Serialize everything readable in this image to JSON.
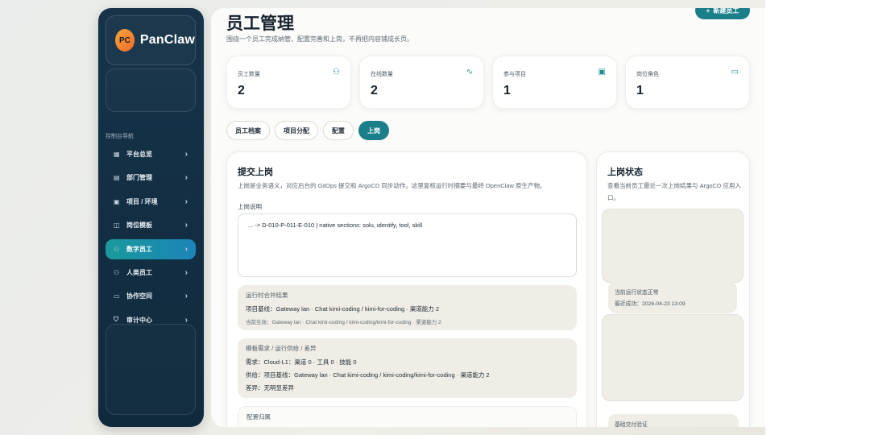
{
  "brand": {
    "badge": "PC",
    "name": "PanClaw"
  },
  "nav": {
    "section_title": "控制台导航",
    "items": [
      {
        "label": "平台总览",
        "icon": "grid-icon",
        "glyph": "▦",
        "active": false
      },
      {
        "label": "部门管理",
        "icon": "building-icon",
        "glyph": "▤",
        "active": false
      },
      {
        "label": "项目 / 环境",
        "icon": "folder-icon",
        "glyph": "▣",
        "active": false
      },
      {
        "label": "岗位模板",
        "icon": "template-icon",
        "glyph": "◫",
        "active": false
      },
      {
        "label": "数字员工",
        "icon": "users-icon",
        "glyph": "⚇",
        "active": true
      },
      {
        "label": "人类员工",
        "icon": "user-icon",
        "glyph": "⚇",
        "active": false
      },
      {
        "label": "协作空间",
        "icon": "chat-icon",
        "glyph": "▭",
        "active": false
      },
      {
        "label": "审计中心",
        "icon": "shield-icon",
        "glyph": "⛉",
        "active": false
      }
    ]
  },
  "header": {
    "title": "员工管理",
    "subtitle": "围绕一个员工完成纳管、配置完善和上岗，不再把内容铺成长页。",
    "new_button": "新建员工",
    "new_button_icon": "+"
  },
  "stats": [
    {
      "label": "员工数量",
      "value": "2",
      "icon": "users-icon",
      "glyph": "⚇"
    },
    {
      "label": "在线数量",
      "value": "2",
      "icon": "activity-icon",
      "glyph": "∿"
    },
    {
      "label": "参与项目",
      "value": "1",
      "icon": "folder-icon",
      "glyph": "▣"
    },
    {
      "label": "岗位角色",
      "value": "1",
      "icon": "briefcase-icon",
      "glyph": "▭"
    }
  ],
  "tabs": [
    "员工档案",
    "项目分配",
    "配置",
    "上岗"
  ],
  "submit": {
    "title": "提交上岗",
    "desc": "上岗是业务语义，对应后台的 GitOps 提交和 ArgoCD 同步动作。这里复核运行时摘要与最终 OpenClaw 原生产物。",
    "field_label": "上岗说明",
    "textarea_value": "... -> D-010-P-011-E-010 | native sections: solu, identify, tool, skill",
    "merge": {
      "heading": "运行时合并结果",
      "line1": "项目基线：Gateway lan · Chat kimi-coding / kimi-for-coding · 渠道能力 2",
      "line2": "当前生效：Gateway lan · Chat kimi-coding / kimi-coding/kimi-for-coding · 渠道能力 2"
    },
    "diff": {
      "heading": "模板需求 / 运行供给 / 差异",
      "demand": "需求：Cloud-L1：渠道 0 · 工具 0 · 技能 0",
      "supply": "供给：项目基线：Gateway lan · Chat kimi-coding / kimi-coding/kimi-for-coding · 渠道能力 2",
      "gap": "差异：无明显差异"
    },
    "config": {
      "heading": "配置归属"
    }
  },
  "status": {
    "title": "上岗状态",
    "desc": "查看当前员工最近一次上岗结果与 ArgoCD 应用入口。",
    "runtime_ok": "当前运行状态正常",
    "last_success": "最近成功：2026-04-23 13:09",
    "verify_heading": "基础交付验证"
  }
}
